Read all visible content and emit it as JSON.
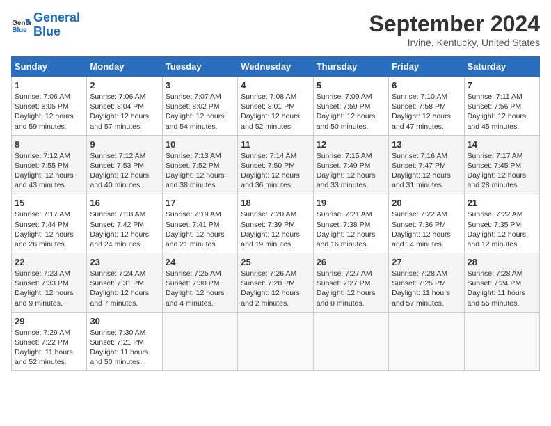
{
  "logo": {
    "line1": "General",
    "line2": "Blue"
  },
  "title": "September 2024",
  "subtitle": "Irvine, Kentucky, United States",
  "weekdays": [
    "Sunday",
    "Monday",
    "Tuesday",
    "Wednesday",
    "Thursday",
    "Friday",
    "Saturday"
  ],
  "weeks": [
    [
      {
        "day": "1",
        "info": "Sunrise: 7:06 AM\nSunset: 8:05 PM\nDaylight: 12 hours\nand 59 minutes."
      },
      {
        "day": "2",
        "info": "Sunrise: 7:06 AM\nSunset: 8:04 PM\nDaylight: 12 hours\nand 57 minutes."
      },
      {
        "day": "3",
        "info": "Sunrise: 7:07 AM\nSunset: 8:02 PM\nDaylight: 12 hours\nand 54 minutes."
      },
      {
        "day": "4",
        "info": "Sunrise: 7:08 AM\nSunset: 8:01 PM\nDaylight: 12 hours\nand 52 minutes."
      },
      {
        "day": "5",
        "info": "Sunrise: 7:09 AM\nSunset: 7:59 PM\nDaylight: 12 hours\nand 50 minutes."
      },
      {
        "day": "6",
        "info": "Sunrise: 7:10 AM\nSunset: 7:58 PM\nDaylight: 12 hours\nand 47 minutes."
      },
      {
        "day": "7",
        "info": "Sunrise: 7:11 AM\nSunset: 7:56 PM\nDaylight: 12 hours\nand 45 minutes."
      }
    ],
    [
      {
        "day": "8",
        "info": "Sunrise: 7:12 AM\nSunset: 7:55 PM\nDaylight: 12 hours\nand 43 minutes."
      },
      {
        "day": "9",
        "info": "Sunrise: 7:12 AM\nSunset: 7:53 PM\nDaylight: 12 hours\nand 40 minutes."
      },
      {
        "day": "10",
        "info": "Sunrise: 7:13 AM\nSunset: 7:52 PM\nDaylight: 12 hours\nand 38 minutes."
      },
      {
        "day": "11",
        "info": "Sunrise: 7:14 AM\nSunset: 7:50 PM\nDaylight: 12 hours\nand 36 minutes."
      },
      {
        "day": "12",
        "info": "Sunrise: 7:15 AM\nSunset: 7:49 PM\nDaylight: 12 hours\nand 33 minutes."
      },
      {
        "day": "13",
        "info": "Sunrise: 7:16 AM\nSunset: 7:47 PM\nDaylight: 12 hours\nand 31 minutes."
      },
      {
        "day": "14",
        "info": "Sunrise: 7:17 AM\nSunset: 7:45 PM\nDaylight: 12 hours\nand 28 minutes."
      }
    ],
    [
      {
        "day": "15",
        "info": "Sunrise: 7:17 AM\nSunset: 7:44 PM\nDaylight: 12 hours\nand 26 minutes."
      },
      {
        "day": "16",
        "info": "Sunrise: 7:18 AM\nSunset: 7:42 PM\nDaylight: 12 hours\nand 24 minutes."
      },
      {
        "day": "17",
        "info": "Sunrise: 7:19 AM\nSunset: 7:41 PM\nDaylight: 12 hours\nand 21 minutes."
      },
      {
        "day": "18",
        "info": "Sunrise: 7:20 AM\nSunset: 7:39 PM\nDaylight: 12 hours\nand 19 minutes."
      },
      {
        "day": "19",
        "info": "Sunrise: 7:21 AM\nSunset: 7:38 PM\nDaylight: 12 hours\nand 16 minutes."
      },
      {
        "day": "20",
        "info": "Sunrise: 7:22 AM\nSunset: 7:36 PM\nDaylight: 12 hours\nand 14 minutes."
      },
      {
        "day": "21",
        "info": "Sunrise: 7:22 AM\nSunset: 7:35 PM\nDaylight: 12 hours\nand 12 minutes."
      }
    ],
    [
      {
        "day": "22",
        "info": "Sunrise: 7:23 AM\nSunset: 7:33 PM\nDaylight: 12 hours\nand 9 minutes."
      },
      {
        "day": "23",
        "info": "Sunrise: 7:24 AM\nSunset: 7:31 PM\nDaylight: 12 hours\nand 7 minutes."
      },
      {
        "day": "24",
        "info": "Sunrise: 7:25 AM\nSunset: 7:30 PM\nDaylight: 12 hours\nand 4 minutes."
      },
      {
        "day": "25",
        "info": "Sunrise: 7:26 AM\nSunset: 7:28 PM\nDaylight: 12 hours\nand 2 minutes."
      },
      {
        "day": "26",
        "info": "Sunrise: 7:27 AM\nSunset: 7:27 PM\nDaylight: 12 hours\nand 0 minutes."
      },
      {
        "day": "27",
        "info": "Sunrise: 7:28 AM\nSunset: 7:25 PM\nDaylight: 11 hours\nand 57 minutes."
      },
      {
        "day": "28",
        "info": "Sunrise: 7:28 AM\nSunset: 7:24 PM\nDaylight: 11 hours\nand 55 minutes."
      }
    ],
    [
      {
        "day": "29",
        "info": "Sunrise: 7:29 AM\nSunset: 7:22 PM\nDaylight: 11 hours\nand 52 minutes."
      },
      {
        "day": "30",
        "info": "Sunrise: 7:30 AM\nSunset: 7:21 PM\nDaylight: 11 hours\nand 50 minutes."
      },
      {
        "day": "",
        "info": ""
      },
      {
        "day": "",
        "info": ""
      },
      {
        "day": "",
        "info": ""
      },
      {
        "day": "",
        "info": ""
      },
      {
        "day": "",
        "info": ""
      }
    ]
  ]
}
